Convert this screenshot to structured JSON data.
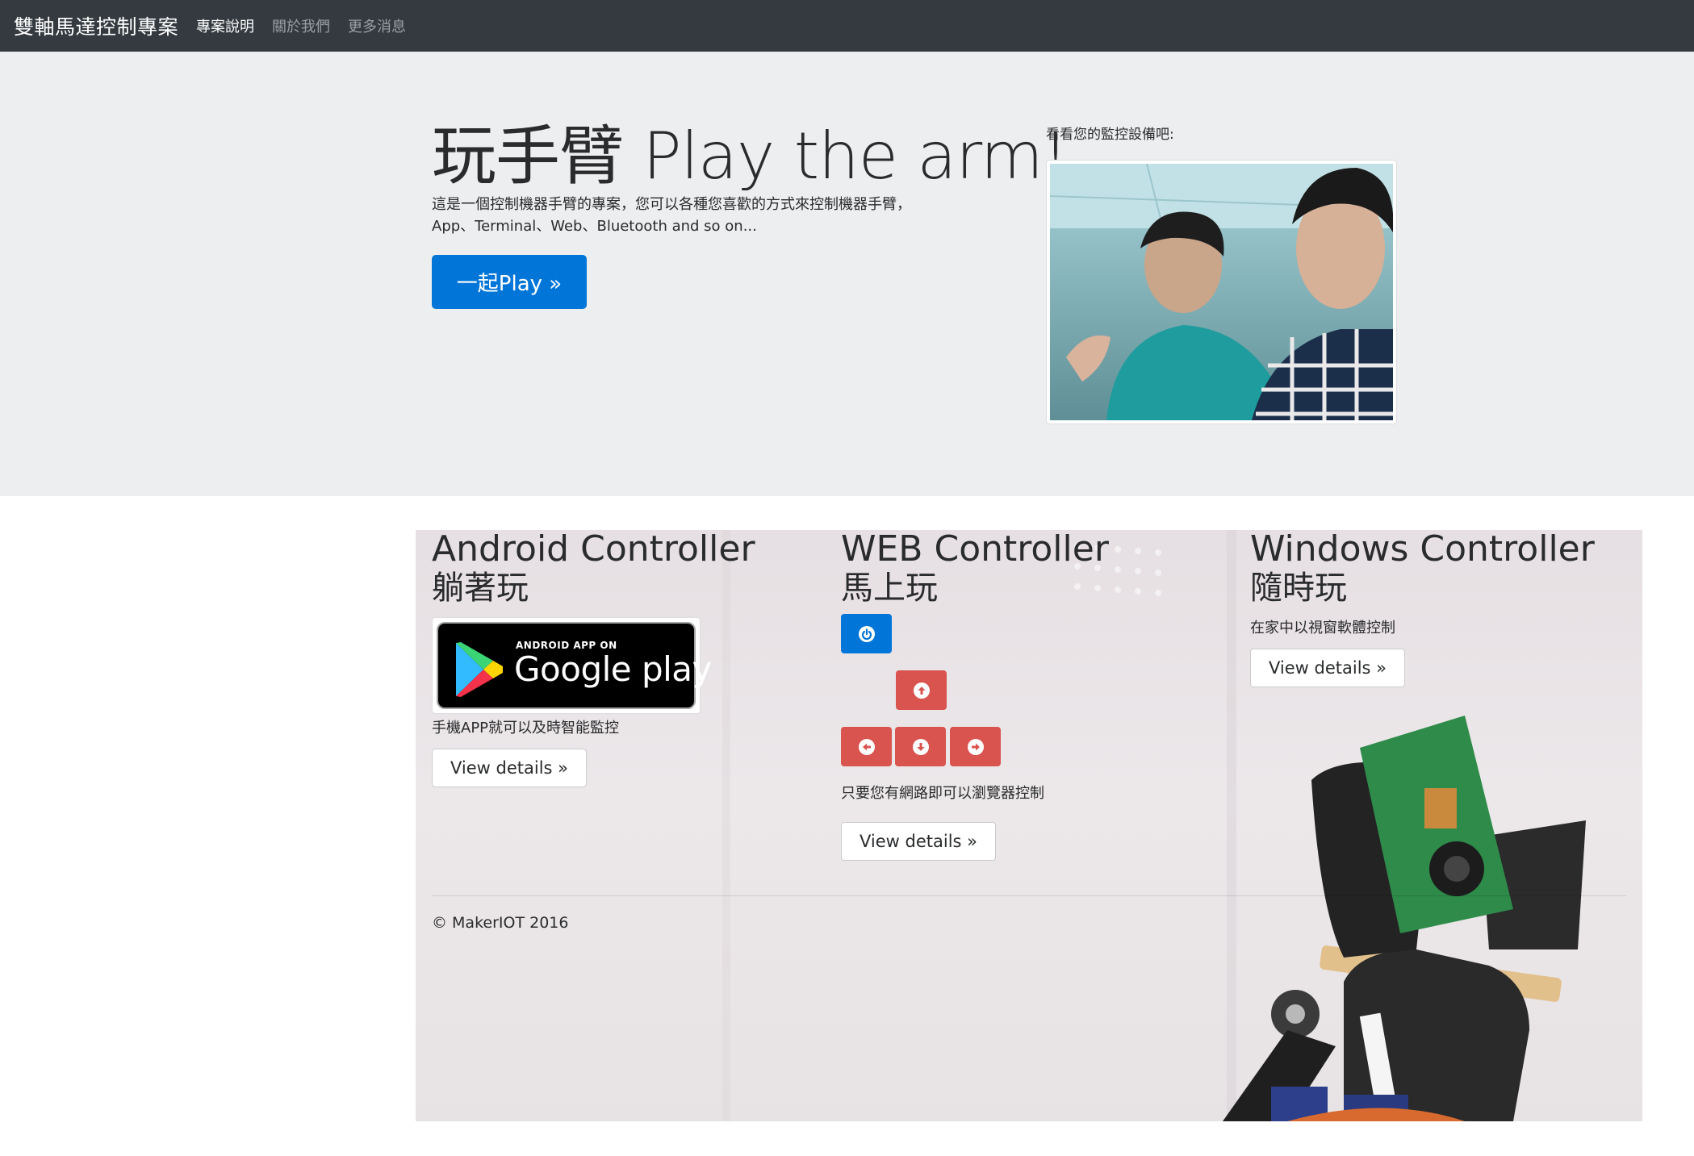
{
  "navbar": {
    "brand": "雙軸馬達控制專案",
    "links": [
      {
        "label": "專案說明",
        "active": true
      },
      {
        "label": "關於我們",
        "active": false
      },
      {
        "label": "更多消息",
        "active": false
      }
    ]
  },
  "hero": {
    "title": "玩手臂 Play the arm!",
    "description_line1": "這是一個控制機器手臂的專案，您可以各種您喜歡的方式來控制機器手臂，",
    "description_line2": "App、Terminal、Web、Bluetooth and so on...",
    "button_label": "一起Play »",
    "camera_label": "看看您的監控設備吧:"
  },
  "features": [
    {
      "title": "Android Controller",
      "subtitle": "躺著玩",
      "badge_small": "ANDROID APP ON",
      "badge_big": "Google play",
      "text": "手機APP就可以及時智能監控",
      "button_label": "View details »"
    },
    {
      "title": "WEB Controller",
      "subtitle": "馬上玩",
      "controls": [
        "power-icon",
        "arrow-up-icon",
        "arrow-left-icon",
        "arrow-down-icon",
        "arrow-right-icon"
      ],
      "text": "只要您有網路即可以瀏覽器控制",
      "button_label": "View details »"
    },
    {
      "title": "Windows Controller",
      "subtitle": "隨時玩",
      "text": "在家中以視窗軟體控制",
      "button_label": "View details »"
    }
  ],
  "footer": {
    "copyright": "© MakerIOT 2016"
  },
  "colors": {
    "navbar": "#343a40",
    "jumbotron": "#eceeef",
    "primary": "#0275d8",
    "danger": "#d9534f"
  }
}
